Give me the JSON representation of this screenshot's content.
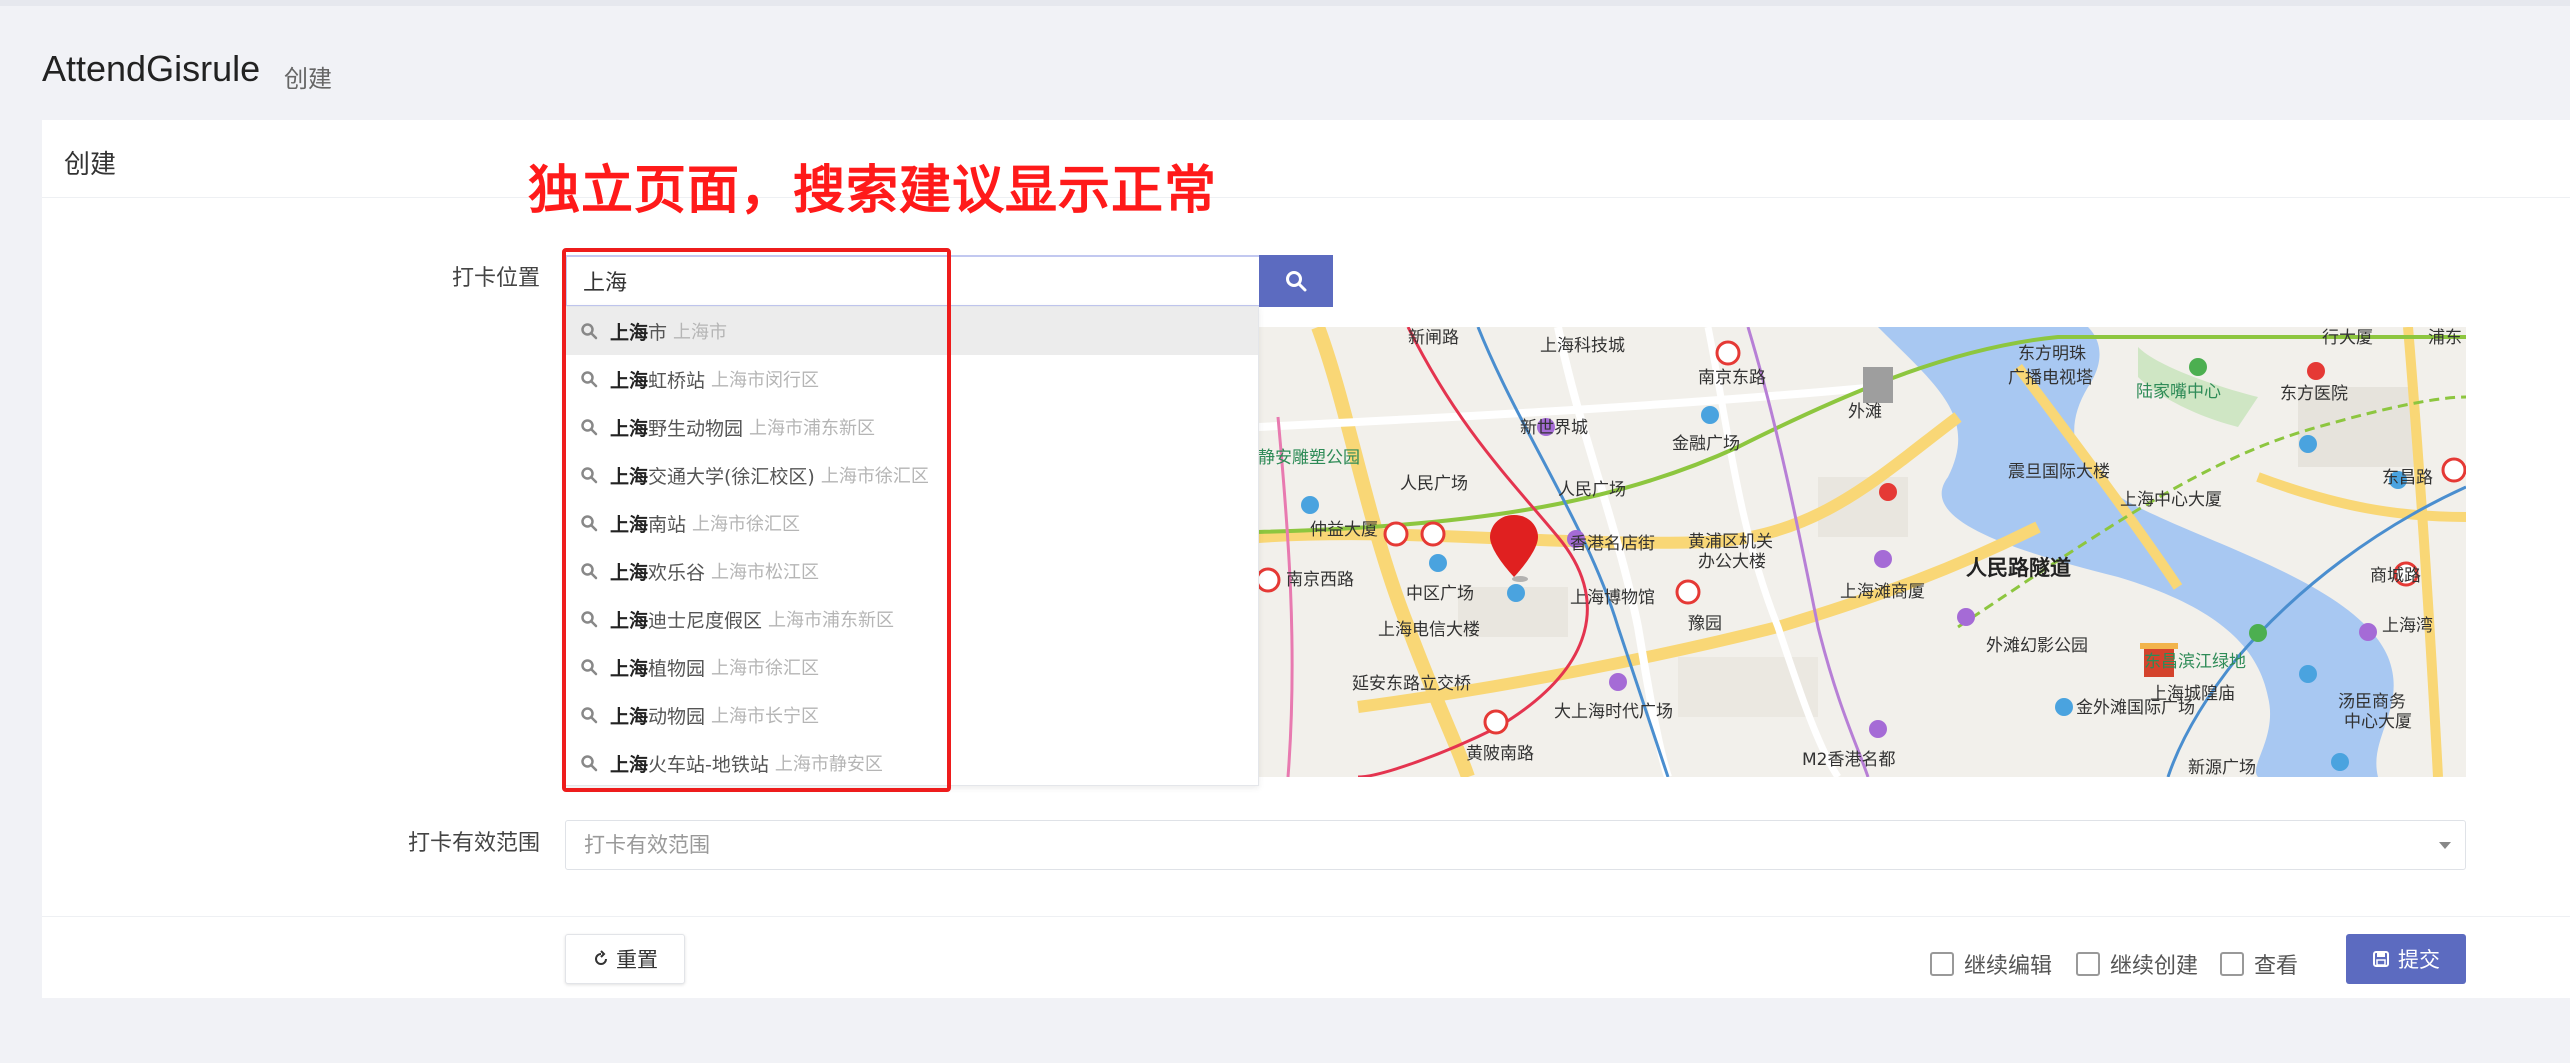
{
  "page": {
    "title": "AttendGisrule",
    "subtitle": "创建"
  },
  "card": {
    "title": "创建"
  },
  "annotation": "独立页面，搜索建议显示正常",
  "form": {
    "location_label": "打卡位置",
    "search_value": "上海",
    "range_label": "打卡有效范围",
    "range_placeholder": "打卡有效范围"
  },
  "suggestions": [
    {
      "keyword": "上海",
      "rest": "市",
      "region": "上海市"
    },
    {
      "keyword": "上海",
      "rest": "虹桥站",
      "region": "上海市闵行区"
    },
    {
      "keyword": "上海",
      "rest": "野生动物园",
      "region": "上海市浦东新区"
    },
    {
      "keyword": "上海",
      "rest": "交通大学(徐汇校区)",
      "region": "上海市徐汇区"
    },
    {
      "keyword": "上海",
      "rest": "南站",
      "region": "上海市徐汇区"
    },
    {
      "keyword": "上海",
      "rest": "欢乐谷",
      "region": "上海市松江区"
    },
    {
      "keyword": "上海",
      "rest": "迪士尼度假区",
      "region": "上海市浦东新区"
    },
    {
      "keyword": "上海",
      "rest": "植物园",
      "region": "上海市徐汇区"
    },
    {
      "keyword": "上海",
      "rest": "动物园",
      "region": "上海市长宁区"
    },
    {
      "keyword": "上海",
      "rest": "火车站-地铁站",
      "region": "上海市静安区"
    }
  ],
  "map_labels": {
    "xinzha": "新闸路",
    "keji": "上海科技城",
    "nanjingdong": "南京东路",
    "dongfang": "东方明珠",
    "guangbo": "广播电视塔",
    "lujiazui": "陆家嘴中心",
    "dongfangyy": "东方医院",
    "xingda": "行大厦",
    "pudong": "浦东",
    "waitan": "外滩",
    "xinshijie": "新世界城",
    "jingan": "静安雕塑公园",
    "jinrong": "金融广场",
    "renmin1": "人民广场",
    "renmin2": "人民广场",
    "zhenhe": "震旦国际大楼",
    "shzx": "上海中心大厦",
    "dongchang": "东昌路",
    "zhongyi": "仲益大厦",
    "xianggang": "香港名店街",
    "huangpu1": "黄浦区机关",
    "huangpu2": "办公大楼",
    "shangcheng": "商城路",
    "nanjingxi": "南京西路",
    "zhongqu": "中区广场",
    "bowuguan": "上海博物馆",
    "tanshang": "上海滩商厦",
    "renminsuidao": "人民路隧道",
    "yuyuan": "豫园",
    "waitanhuanying": "外滩幻影公园",
    "dianxin": "上海电信大楼",
    "shangwan": "上海湾",
    "yanan": "延安东路立交桥",
    "chenghuang": "上海城隍庙",
    "dongchangbin": "东昌滨江绿地",
    "tangchen1": "汤臣商务",
    "tangchen2": "中心大厦",
    "shidai": "大上海时代广场",
    "jinwaitan": "金外滩国际广场",
    "huangpi": "黄陂南路",
    "m2": "M2香港名都",
    "xinyuan": "新源广场"
  },
  "footer": {
    "reset_label": "重置",
    "continue_edit": "继续编辑",
    "continue_create": "继续创建",
    "view": "查看",
    "submit_label": "提交"
  },
  "colors": {
    "accent": "#5c6bc0",
    "annotation": "#ff1a1a",
    "river": "#a8c8f2",
    "road_major": "#f9d776"
  },
  "icons": {
    "search": "search-icon",
    "reset": "refresh-icon",
    "submit": "save-icon",
    "marker": "map-marker-icon"
  }
}
